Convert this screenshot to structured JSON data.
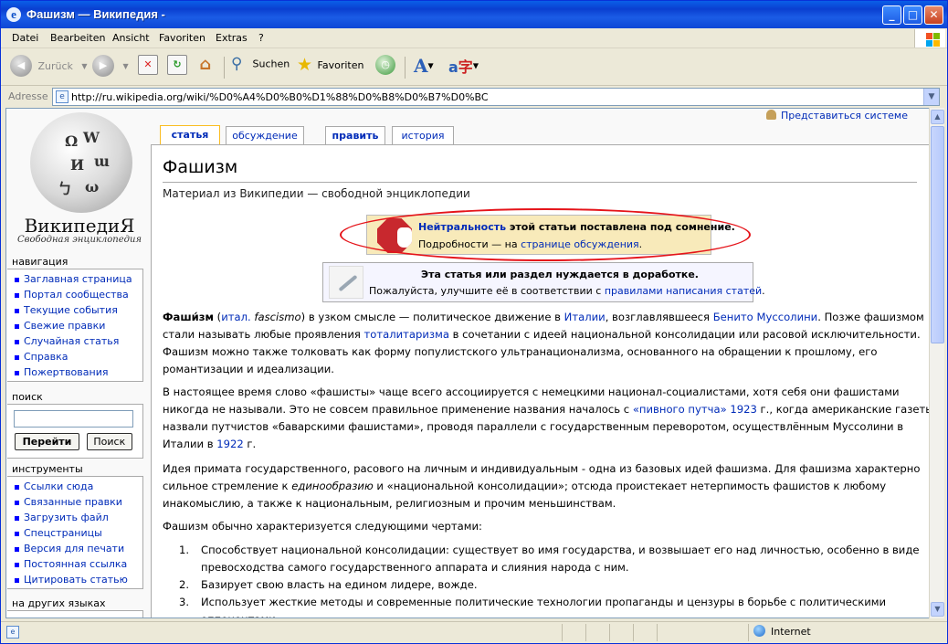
{
  "window": {
    "title": "Фашизм — Википедия -",
    "min_glyph": "_",
    "max_glyph": "□",
    "close_glyph": "✕"
  },
  "menu": [
    "Datei",
    "Bearbeiten",
    "Ansicht",
    "Favoriten",
    "Extras",
    "?"
  ],
  "toolbar": {
    "back": "Zurück",
    "search": "Suchen",
    "favorites": "Favoriten"
  },
  "address": {
    "label": "Adresse",
    "url": "http://ru.wikipedia.org/wiki/%D0%A4%D0%B0%D1%88%D0%B8%D0%B7%D0%BC"
  },
  "logo": {
    "name": "ВикипедиЯ",
    "tagline": "Свободная энциклопедия"
  },
  "sidebar": {
    "nav_title": "навигация",
    "nav_items": [
      "Заглавная страница",
      "Портал сообщества",
      "Текущие события",
      "Свежие правки",
      "Случайная статья",
      "Справка",
      "Пожертвования"
    ],
    "search_title": "поиск",
    "search_go": "Перейти",
    "search_btn": "Поиск",
    "tools_title": "инструменты",
    "tools_items": [
      "Ссылки сюда",
      "Связанные правки",
      "Загрузить файл",
      "Спецстраницы",
      "Версия для печати",
      "Постоянная ссылка",
      "Цитировать статью"
    ],
    "lang_title": "на других языках"
  },
  "login": "Представиться системе",
  "tabs": [
    "статья",
    "обсуждение",
    "править",
    "история"
  ],
  "article": {
    "title": "Фашизм",
    "subtitle": "Материал из Википедии — свободной энциклопедии",
    "notice1": {
      "link": "Нейтральность",
      "text": " этой статьи поставлена под сомнение.",
      "line2_pre": "Подробности — на ",
      "line2_link": "странице обсуждения",
      "line2_post": "."
    },
    "notice2": {
      "line1": "Эта статья или раздел нуждается в доработке.",
      "line2_pre": "Пожалуйста, улучшите её в соответствии с ",
      "line2_link": "правилами написания статей",
      "line2_post": "."
    },
    "p1": {
      "l1": [
        "Фаши́зм",
        " (",
        "итал.",
        " ",
        "fascismo",
        ") в узком смысле — политическое движение в ",
        "Италии",
        ", возглавлявшееся ",
        "Бенито Муссолини",
        ". Позже фашизмом"
      ],
      "l2": [
        "стали называть любые проявления ",
        "тоталитаризма",
        " в сочетании с идеей национальной консолидации или расовой исключительности."
      ],
      "l3": "Фашизм можно также толковать как форму популистского ультранационализма, основанного на обращении к прошлому, его",
      "l4": "романтизации и идеализации."
    },
    "p2": {
      "l1": "В настоящее время слово «фашисты» чаще всего ассоциируется с немецкими национал-социалистами, хотя себя они фашистами",
      "l2": [
        "никогда не называли. Это не совсем правильное применение названия началось с ",
        "«пивного путча» 1923",
        " г., когда американские газеты"
      ],
      "l3": "назвали путчистов «баварскими фашистами», проводя параллели с государственным переворотом, осуществлённым Муссолини в",
      "l4": [
        "Италии в ",
        "1922",
        " г."
      ]
    },
    "p3": {
      "l1": "Идея примата государственного, расового на личным и индивидуальным - одна из базовых идей фашизма. Для фашизма характерно",
      "l2": [
        "сильное стремление к ",
        "единообразию",
        " и «национальной консолидации»; отсюда проистекает нетерпимость фашистов к любому"
      ],
      "l3": "инакомыслию, а также к национальным, религиозным и прочим меньшинствам."
    },
    "p4": "Фашизм обычно характеризуется следующими чертами:",
    "features": [
      {
        "n": "1.",
        "l1": "Способствует национальной консолидации: существует во имя государства, и возвышает его над личностью, особенно в виде",
        "l2": "превосходства самого государственного аппарата и слияния народа с ним."
      },
      {
        "n": "2.",
        "l1": "Базирует свою власть на едином лидере, вожде.",
        "l2": ""
      },
      {
        "n": "3.",
        "l1": "Использует жесткие методы и современные политические технологии пропаганды и цензуры в борьбе с политическими",
        "l2": "оппонентами."
      }
    ]
  },
  "status": {
    "zone": "Internet"
  },
  "colors": {
    "title_bar": "#0a49d6",
    "link": "#002bb8",
    "highlight_ellipse": "#e5141a",
    "notice_bg": "#f8eaba"
  }
}
